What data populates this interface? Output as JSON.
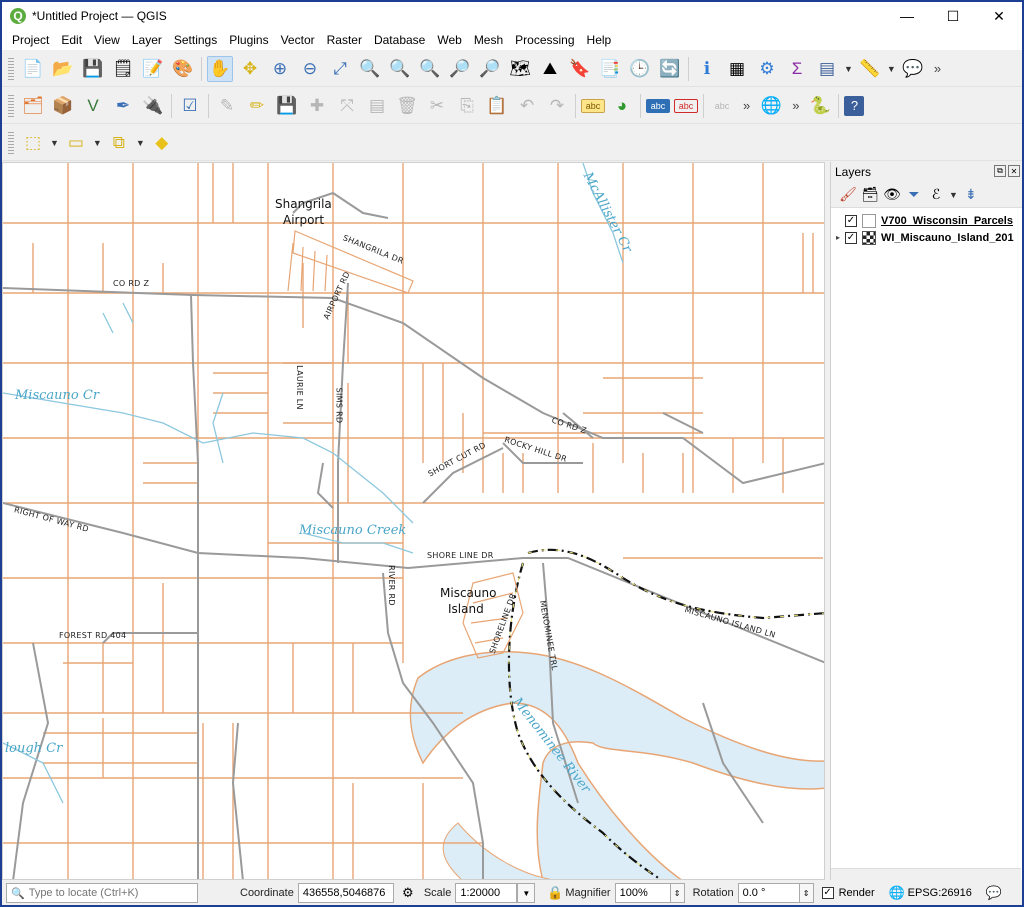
{
  "window": {
    "title": "*Untitled Project — QGIS",
    "app_icon_letter": "Q"
  },
  "window_controls": {
    "minimize": "—",
    "maximize": "☐",
    "close": "✕"
  },
  "menu": [
    "Project",
    "Edit",
    "View",
    "Layer",
    "Settings",
    "Plugins",
    "Vector",
    "Raster",
    "Database",
    "Web",
    "Mesh",
    "Processing",
    "Help"
  ],
  "toolbar_more": "»",
  "map_labels": {
    "shangrila_airport_1": "Shangrila",
    "shangrila_airport_2": "Airport",
    "shangrila_dr": "SHANGRILA DR",
    "co_rd_z": "CO RD Z",
    "airport_rd": "AIRPORT RD",
    "miscauno_cr": "Miscauno Cr",
    "laurie_ln": "LAURIE LN",
    "sims_rd": "SIMS RD",
    "co_rd_z_east": "CO RD Z",
    "short_cut_rd": "SHORT CUT RD",
    "rocky_hill_dr": "ROCKY HILL DR",
    "right_of_way_rd": "RIGHT OF WAY RD",
    "miscauno_creek": "Miscauno Creek",
    "shore_line_dr": "SHORE LINE DR",
    "river_rd": "RIVER RD",
    "miscauno_island_1": "Miscauno",
    "miscauno_island_2": "Island",
    "shoreline_dr": "SHORELINE DR",
    "menominee_trl": "MENOMINEE TRL",
    "miscauno_island_ln": "MISCAUNO ISLAND LN",
    "forest_rd": "FOREST RD 404",
    "mcallister_cr": "McAllister Cr",
    "menominee_river": "Menominee River",
    "slough_cr": "lough Cr"
  },
  "layers_panel": {
    "title": "Layers",
    "layers": [
      {
        "name": "V700_Wisconsin_Parcels",
        "checked": "✓",
        "expander": ""
      },
      {
        "name": "WI_Miscauno_Island_201",
        "checked": "✓",
        "expander": "▸"
      }
    ]
  },
  "statusbar": {
    "locator_placeholder": "Type to locate (Ctrl+K)",
    "coordinate_label": "Coordinate",
    "coordinate_value": "436558,5046876",
    "scale_label": "Scale",
    "scale_value": "1:20000",
    "magnifier_label": "Magnifier",
    "magnifier_value": "100%",
    "rotation_label": "Rotation",
    "rotation_value": "0.0 °",
    "render_label": "Render",
    "render_checked": "✓",
    "crs_label": "EPSG:26916"
  },
  "colors": {
    "parcel_line": "#e8a574",
    "road_line": "#999999",
    "water_fill": "#dcedf7",
    "water_text": "#4aa6c8",
    "title_border": "#1c3f94"
  }
}
